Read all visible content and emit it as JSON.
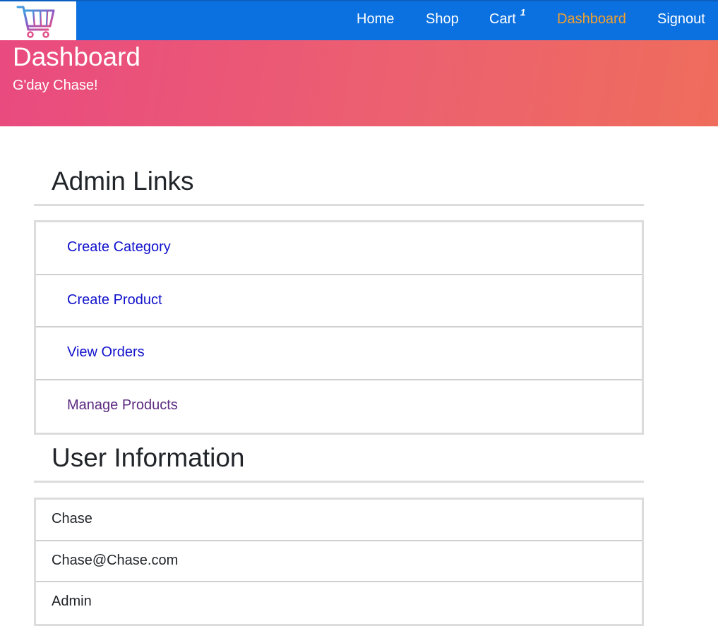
{
  "nav": {
    "logo_icon": "shopping-cart-icon",
    "items": [
      {
        "label": "Home"
      },
      {
        "label": "Shop"
      },
      {
        "label": "Cart",
        "badge": "1"
      },
      {
        "label": "Dashboard",
        "active": true
      },
      {
        "label": "Signout"
      }
    ],
    "colors": {
      "background": "#0c71e0",
      "active": "#f0a030"
    }
  },
  "hero": {
    "title": "Dashboard",
    "subtitle": "G'day Chase!",
    "colors": {
      "start": "#e94a80",
      "end": "#ef6d5c"
    }
  },
  "admin": {
    "heading": "Admin Links",
    "links": [
      {
        "label": "Create Category"
      },
      {
        "label": "Create Product"
      },
      {
        "label": "View Orders"
      },
      {
        "label": "Manage Products"
      }
    ]
  },
  "user": {
    "heading": "User Information",
    "name": "Chase",
    "email": "Chase@Chase.com",
    "role": "Admin"
  }
}
